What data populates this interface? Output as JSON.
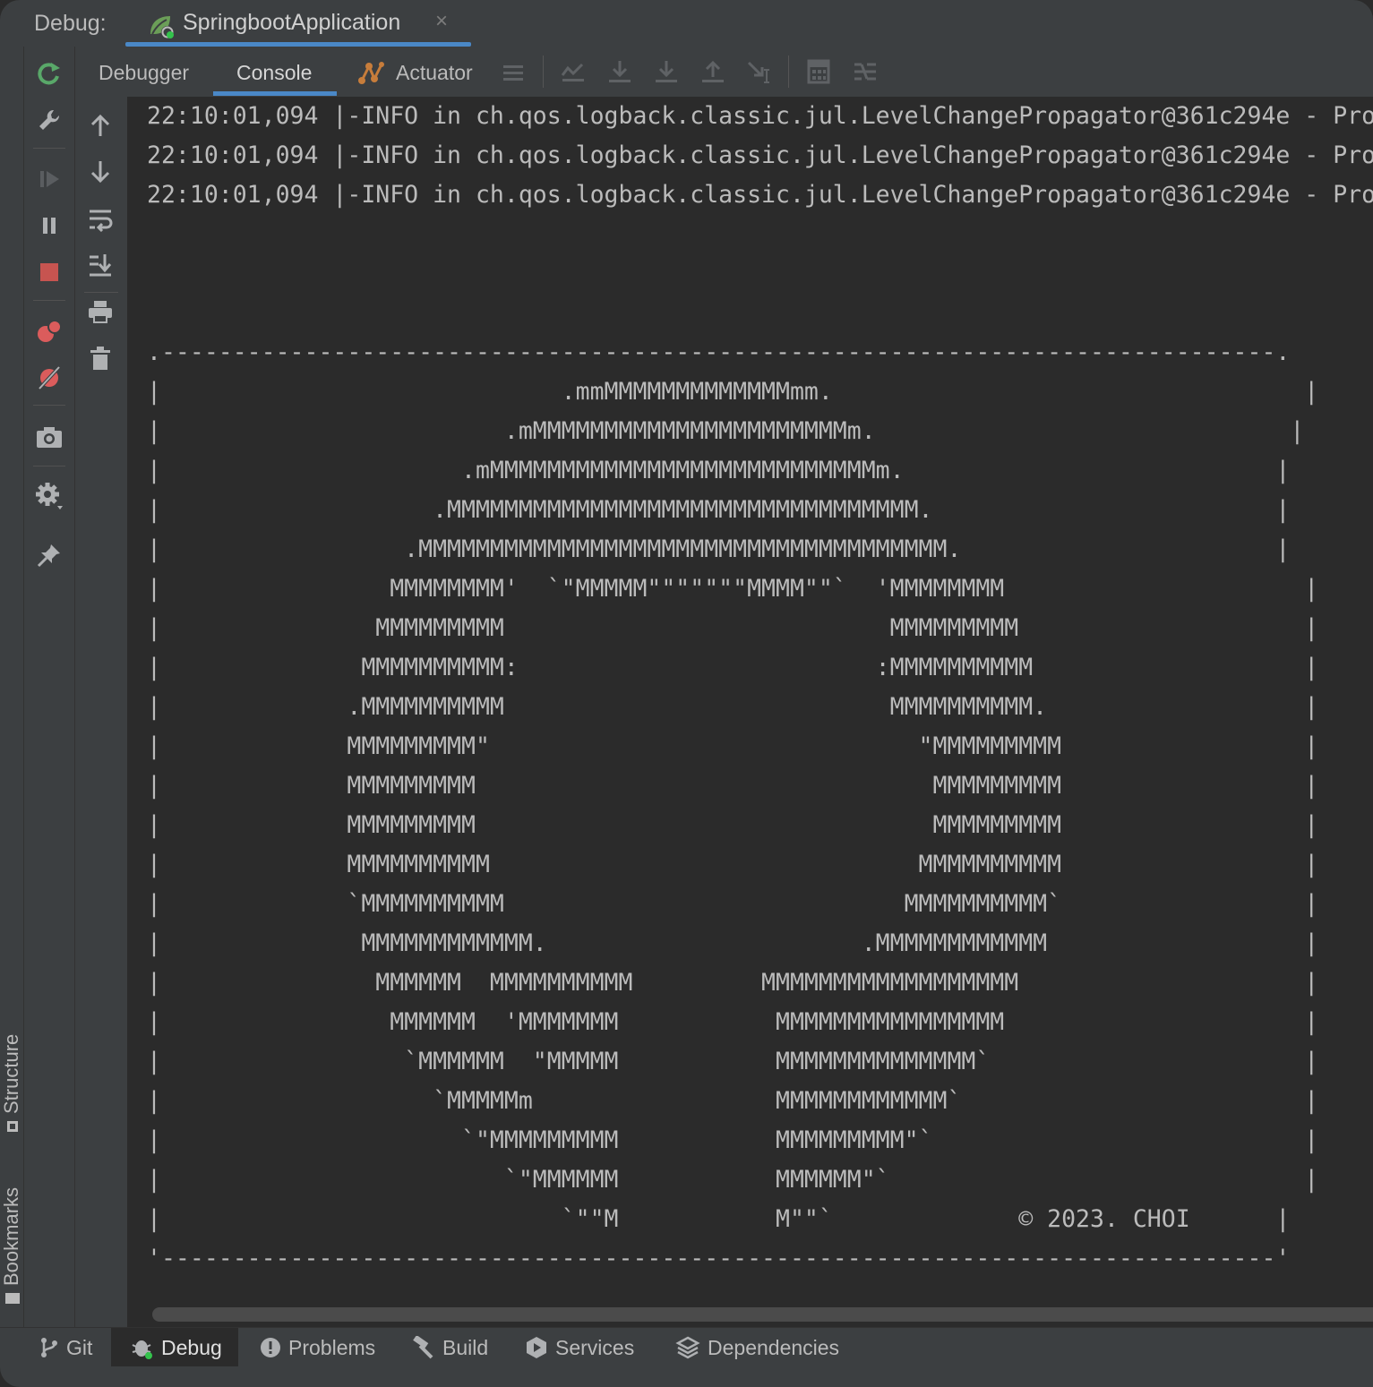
{
  "header": {
    "debug_label": "Debug:",
    "run_config": "SpringbootApplication",
    "close_glyph": "×"
  },
  "tabs": [
    {
      "label": "Debugger"
    },
    {
      "label": "Console",
      "active": true
    },
    {
      "label": "Actuator"
    }
  ],
  "side_tools": {
    "structure": "Structure",
    "bookmarks": "Bookmarks"
  },
  "console_lines": [
    "22:10:01,094 |-INFO in ch.qos.logback.classic.jul.LevelChangePropagator@361c294e - Pro",
    "22:10:01,094 |-INFO in ch.qos.logback.classic.jul.LevelChangePropagator@361c294e - Pro",
    "22:10:01,094 |-INFO in ch.qos.logback.classic.jul.LevelChangePropagator@361c294e - Pro",
    "",
    "",
    "",
    ".------------------------------------------------------------------------------.",
    "|                            .mmMMMMMMMMMMMMMmm.                                 |",
    "|                        .mMMMMMMMMMMMMMMMMMMMMMMm.                             |",
    "|                     .mMMMMMMMMMMMMMMMMMMMMMMMMMMMm.                          |",
    "|                   .MMMMMMMMMMMMMMMMMMMMMMMMMMMMMMMMM.                        |",
    "|                 .MMMMMMMMMMMMMMMMMMMMMMMMMMMMMMMMMMMMM.                      |",
    "|                MMMMMMMM'  `\"MMMMM\"\"\"\"\"\"\"MMMM\"\"`  'MMMMMMMM                     |",
    "|               MMMMMMMMM                           MMMMMMMMM                    |",
    "|              MMMMMMMMMM:                         :MMMMMMMMMM                   |",
    "|             .MMMMMMMMMM                           MMMMMMMMMM.                  |",
    "|             MMMMMMMMM\"                              \"MMMMMMMMM                 |",
    "|             MMMMMMMMM                                MMMMMMMMM                 |",
    "|             MMMMMMMMM                                MMMMMMMMM                 |",
    "|             MMMMMMMMMM                              MMMMMMMMMM                 |",
    "|             `MMMMMMMMMM                            MMMMMMMMMM`                 |",
    "|              MMMMMMMMMMMM.                      .MMMMMMMMMMMM                  |",
    "|               MMMMMM  MMMMMMMMMM         MMMMMMMMMMMMMMMMMM                    |",
    "|                MMMMMM  'MMMMMMM           MMMMMMMMMMMMMMMM                     |",
    "|                 `MMMMMM  \"MMMMM           MMMMMMMMMMMMMM`                      |",
    "|                   `MMMMMm                 MMMMMMMMMMMM`                        |",
    "|                     `\"MMMMMMMMM           MMMMMMMMM\"`                          |",
    "|                        `\"MMMMMM           MMMMMM\"`                             |",
    "|                            `\"\"M           M\"\"`             © 2023. CHOI      |",
    "'------------------------------------------------------------------------------'"
  ],
  "bottom_tabs": [
    {
      "label": "Git",
      "icon": "git-branch-icon"
    },
    {
      "label": "Debug",
      "icon": "bug-icon",
      "active": true
    },
    {
      "label": "Problems",
      "icon": "problems-icon"
    },
    {
      "label": "Build",
      "icon": "hammer-icon"
    },
    {
      "label": "Services",
      "icon": "services-icon"
    },
    {
      "label": "Dependencies",
      "icon": "dependencies-icon"
    }
  ],
  "colors": {
    "accent": "#4a88c7",
    "rerun": "#59a869",
    "stop": "#c75450",
    "breakpoint": "#db5c5c",
    "actuator": "#c77d3b"
  }
}
